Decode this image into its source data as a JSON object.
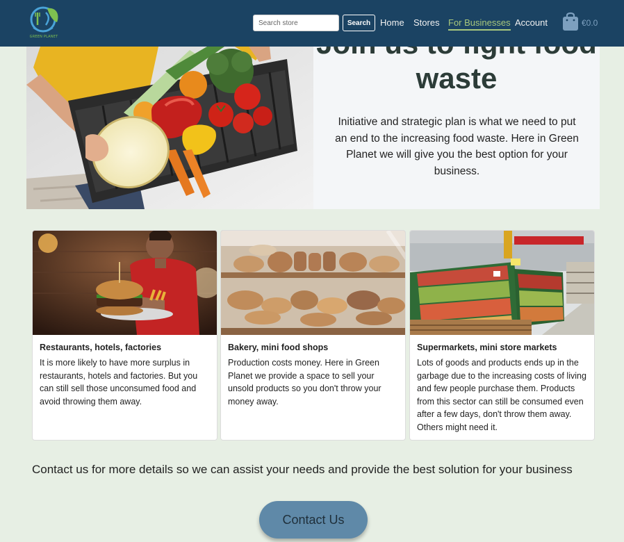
{
  "brand": {
    "logo_text": "GREEN PLANET"
  },
  "nav": {
    "search_placeholder": "Search store",
    "search_button": "Search",
    "links": [
      "Home",
      "Stores",
      "For Businesses",
      "Account"
    ],
    "active": "For Businesses",
    "cart_total": "€0.0"
  },
  "hero": {
    "title": "Join us to fight food waste",
    "description": "Initiative and strategic plan is what we need to put an end to the increasing food waste. Here in Green Planet we will give you the best option for your business."
  },
  "cards": [
    {
      "title": "Restaurants, hotels, factories",
      "text": "It is more likely to have more surplus in restaurants, hotels and factories. But you can still sell those unconsumed food and avoid throwing them away."
    },
    {
      "title": "Bakery, mini food shops",
      "text": "Production costs money. Here in Green Planet we provide a space to sell your unsold products so you don't throw your money away."
    },
    {
      "title": "Supermarkets, mini store markets",
      "text": "Lots of goods and products ends up in the garbage due to the increasing costs of living and few people purchase them. Products from this sector can still be consumed even after a few days, don't throw them away. Others might need it."
    }
  ],
  "contact": {
    "text": "Contact us for more details so we can assist your needs and provide the best solution for your business",
    "button": "Contact Us"
  },
  "colors": {
    "navbar": "#1b4363",
    "accent": "#a8c87d",
    "page_bg": "#e7efe4",
    "button": "#5f89a8"
  }
}
